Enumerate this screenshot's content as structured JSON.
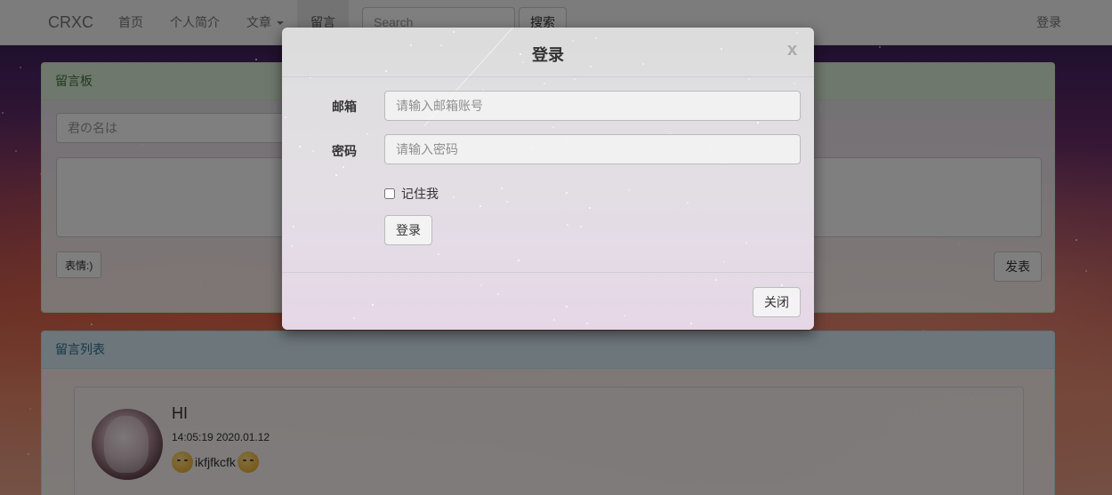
{
  "navbar": {
    "brand": "CRXC",
    "items": [
      {
        "label": "首页"
      },
      {
        "label": "个人简介"
      },
      {
        "label": "文章"
      },
      {
        "label": "留言"
      }
    ],
    "search_placeholder": "Search",
    "search_button": "搜索",
    "login": "登录",
    "dropdown_icon": "caret-down-icon"
  },
  "guestbook": {
    "title": "留言板",
    "name_placeholder": "君の名は",
    "emoji_button": "表情:)",
    "post_button": "发表"
  },
  "message_list": {
    "title": "留言列表",
    "items": [
      {
        "title": "HI",
        "time": "14:05:19 2020.01.12",
        "text": "ikfjfkcfk",
        "avatar_icon": "anime-avatar"
      }
    ]
  },
  "login_modal": {
    "title": "登录",
    "close_symbol": "x",
    "email_label": "邮箱",
    "email_placeholder": "请输入邮箱账号",
    "password_label": "密码",
    "password_placeholder": "请输入密码",
    "remember_label": "记住我",
    "login_button": "登录",
    "close_button": "关闭"
  },
  "colors": {
    "success_heading_bg": "#dff0d8",
    "success_heading_text": "#3c763d",
    "info_heading_bg": "#d9edf7",
    "info_heading_text": "#31708f"
  }
}
